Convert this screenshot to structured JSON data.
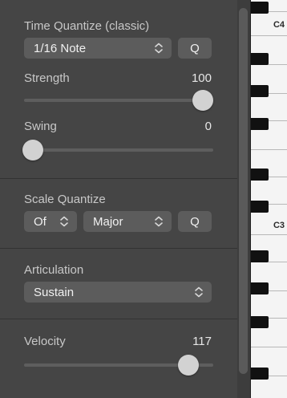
{
  "time_quantize": {
    "title": "Time Quantize (classic)",
    "value": "1/16 Note",
    "q_label": "Q",
    "strength_label": "Strength",
    "strength_value": "100",
    "strength_level": 1.0,
    "swing_label": "Swing",
    "swing_value": "0",
    "swing_level": 0.0
  },
  "scale_quantize": {
    "title": "Scale Quantize",
    "root_value": "Of",
    "scale_value": "Major",
    "q_label": "Q"
  },
  "articulation": {
    "title": "Articulation",
    "value": "Sustain"
  },
  "velocity": {
    "label": "Velocity",
    "value": "117",
    "level": 0.92
  },
  "piano": {
    "labels": [
      "C4",
      "C3"
    ]
  },
  "colors": {
    "panel": "#454545",
    "control": "#5c5c5c",
    "knob": "#d2d2d2"
  }
}
